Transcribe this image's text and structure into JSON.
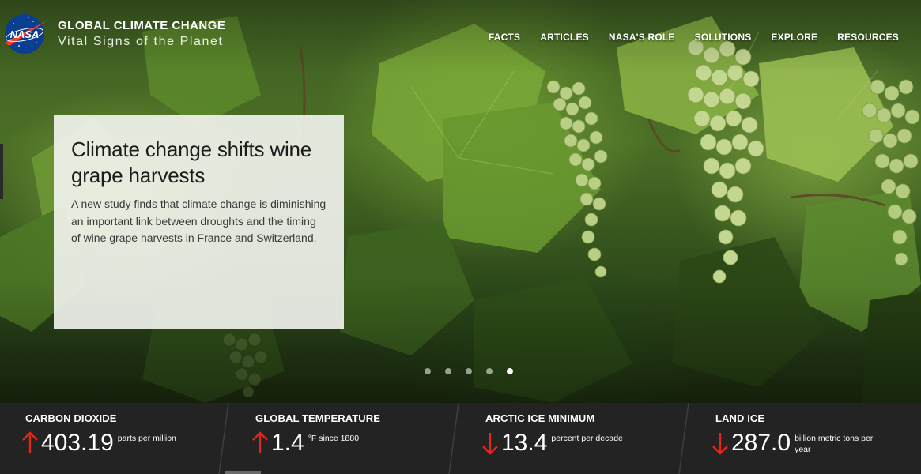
{
  "brand": {
    "logo_text": "NASA",
    "title": "GLOBAL CLIMATE CHANGE",
    "subtitle": "Vital Signs of the Planet"
  },
  "nav": {
    "items": [
      "FACTS",
      "ARTICLES",
      "NASA'S ROLE",
      "SOLUTIONS",
      "EXPLORE",
      "RESOURCES"
    ]
  },
  "feature": {
    "title": "Climate change shifts wine grape harvests",
    "description": "A new study finds that climate change is diminishing an important link between droughts and the timing of wine grape harvests in France and Switzerland."
  },
  "carousel": {
    "slide_count": 5,
    "active_index": 4
  },
  "vital_signs": [
    {
      "name": "CARBON DIOXIDE",
      "trend": "up",
      "value": "403.19",
      "unit": "parts per million"
    },
    {
      "name": "GLOBAL TEMPERATURE",
      "trend": "up",
      "value": "1.4",
      "unit": "°F since 1880"
    },
    {
      "name": "ARCTIC ICE MINIMUM",
      "trend": "down",
      "value": "13.4",
      "unit": "percent per decade"
    },
    {
      "name": "LAND ICE",
      "trend": "down",
      "value": "287.0",
      "unit": "billion metric tons per year"
    }
  ],
  "colors": {
    "trend_arrow": "#e1261c",
    "vitals_bar": "#232323",
    "nasa_blue": "#0b3d91",
    "nasa_red": "#fc3d21"
  }
}
